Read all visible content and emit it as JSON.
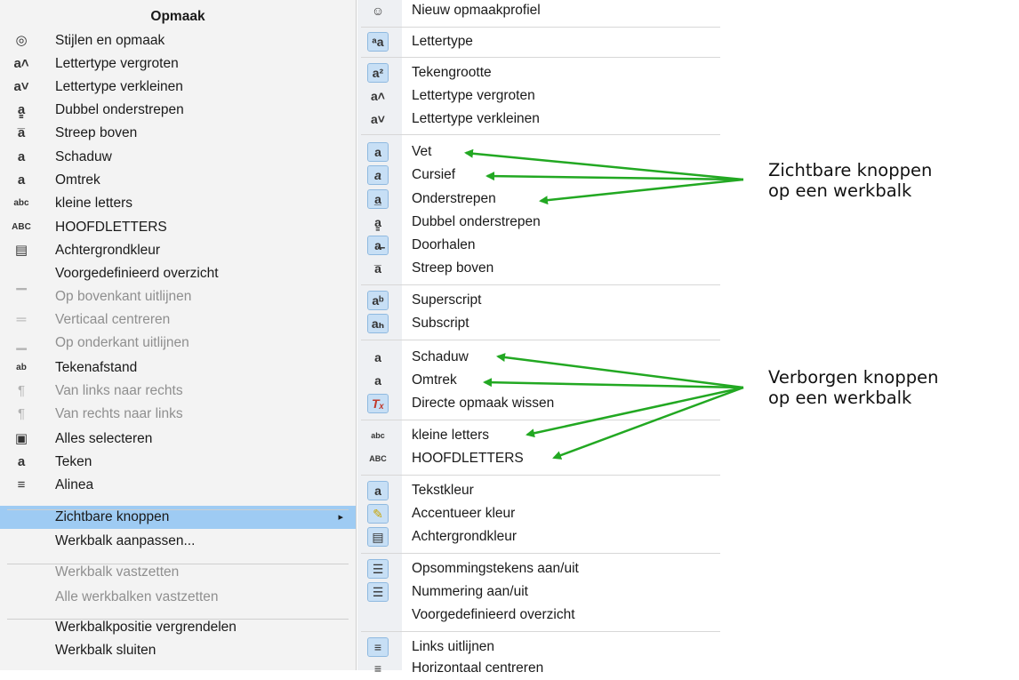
{
  "left_menu": {
    "title": "Opmaak",
    "items": [
      {
        "label": "Stijlen en opmaak",
        "icon": "styles-icon",
        "glyph": "◎",
        "disabled": false
      },
      {
        "label": "Lettertype vergroten",
        "icon": "font-grow-icon",
        "glyph": "a˄",
        "disabled": false
      },
      {
        "label": "Lettertype verkleinen",
        "icon": "font-shrink-icon",
        "glyph": "a˅",
        "disabled": false
      },
      {
        "label": "Dubbel onderstrepen",
        "icon": "double-underline-icon",
        "glyph": "a̳",
        "disabled": false
      },
      {
        "label": "Streep boven",
        "icon": "overline-icon",
        "glyph": "a̅",
        "disabled": false
      },
      {
        "label": "Schaduw",
        "icon": "shadow-icon",
        "glyph": "a",
        "disabled": false
      },
      {
        "label": "Omtrek",
        "icon": "outline-icon",
        "glyph": "a",
        "disabled": false
      },
      {
        "label": "kleine letters",
        "icon": "lowercase-icon",
        "glyph": "abc",
        "disabled": false
      },
      {
        "label": "HOOFDLETTERS",
        "icon": "uppercase-icon",
        "glyph": "ABC",
        "disabled": false
      },
      {
        "label": "Achtergrondkleur",
        "icon": "background-color-icon",
        "glyph": "▤",
        "disabled": false
      },
      {
        "label": "Voorgedefinieerd overzicht",
        "icon": "",
        "glyph": "",
        "disabled": false
      },
      {
        "label": "Op bovenkant uitlijnen",
        "icon": "align-top-icon",
        "glyph": "▔",
        "disabled": true
      },
      {
        "label": "Verticaal centreren",
        "icon": "align-middle-icon",
        "glyph": "═",
        "disabled": true
      },
      {
        "label": "Op onderkant uitlijnen",
        "icon": "align-bottom-icon",
        "glyph": "▁",
        "disabled": true
      },
      {
        "label": "Tekenafstand",
        "icon": "char-spacing-icon",
        "glyph": "ab",
        "disabled": false
      },
      {
        "label": "Van links naar rechts",
        "icon": "ltr-icon",
        "glyph": "¶",
        "disabled": true
      },
      {
        "label": "Van rechts naar links",
        "icon": "rtl-icon",
        "glyph": "¶",
        "disabled": true
      },
      {
        "label": "Alles selecteren",
        "icon": "select-all-icon",
        "glyph": "▣",
        "disabled": false
      },
      {
        "label": "Teken",
        "icon": "character-icon",
        "glyph": "a",
        "disabled": false
      },
      {
        "label": "Alinea",
        "icon": "paragraph-icon",
        "glyph": "≡",
        "disabled": false
      },
      {
        "label": "Zichtbare knoppen",
        "icon": "",
        "glyph": "",
        "disabled": false,
        "selected": true,
        "submenu_arrow": "▸"
      },
      {
        "label": "Werkbalk aanpassen...",
        "icon": "",
        "glyph": "",
        "disabled": false
      },
      {
        "label": "Werkbalk vastzetten",
        "icon": "",
        "glyph": "",
        "disabled": true
      },
      {
        "label": "Alle werkbalken vastzetten",
        "icon": "",
        "glyph": "",
        "disabled": true
      },
      {
        "label": "Werkbalkpositie vergrendelen",
        "icon": "",
        "glyph": "",
        "disabled": false
      },
      {
        "label": "Werkbalk sluiten",
        "icon": "",
        "glyph": "",
        "disabled": false
      }
    ]
  },
  "right_menu": {
    "items": [
      {
        "label": "Nieuw opmaakprofiel",
        "icon": "new-style-icon",
        "glyph": "☺",
        "checked": false
      },
      {
        "label": "Lettertype",
        "icon": "font-name-icon",
        "glyph": "ᵃa",
        "checked": true
      },
      {
        "label": "Tekengrootte",
        "icon": "font-size-icon",
        "glyph": "a²",
        "checked": true
      },
      {
        "label": "Lettertype vergroten",
        "icon": "font-grow-icon",
        "glyph": "a˄",
        "checked": false
      },
      {
        "label": "Lettertype verkleinen",
        "icon": "font-shrink-icon",
        "glyph": "a˅",
        "checked": false
      },
      {
        "label": "Vet",
        "icon": "bold-icon",
        "glyph": "a",
        "checked": true
      },
      {
        "label": "Cursief",
        "icon": "italic-icon",
        "glyph": "a",
        "checked": true
      },
      {
        "label": "Onderstrepen",
        "icon": "underline-icon",
        "glyph": "a̲",
        "checked": true
      },
      {
        "label": "Dubbel onderstrepen",
        "icon": "double-underline-icon",
        "glyph": "a̳",
        "checked": false
      },
      {
        "label": "Doorhalen",
        "icon": "strikethrough-icon",
        "glyph": "a̶",
        "checked": true
      },
      {
        "label": "Streep boven",
        "icon": "overline-icon",
        "glyph": "a̅",
        "checked": false
      },
      {
        "label": "Superscript",
        "icon": "superscript-icon",
        "glyph": "aᵇ",
        "checked": true
      },
      {
        "label": "Subscript",
        "icon": "subscript-icon",
        "glyph": "aₕ",
        "checked": true
      },
      {
        "label": "Schaduw",
        "icon": "shadow-icon",
        "glyph": "a",
        "checked": false
      },
      {
        "label": "Omtrek",
        "icon": "outline-icon",
        "glyph": "a",
        "checked": false
      },
      {
        "label": "Directe opmaak wissen",
        "icon": "clear-formatting-icon",
        "glyph": "Tₓ",
        "checked": true
      },
      {
        "label": "kleine letters",
        "icon": "lowercase-icon",
        "glyph": "abc",
        "checked": false
      },
      {
        "label": "HOOFDLETTERS",
        "icon": "uppercase-icon",
        "glyph": "ABC",
        "checked": false
      },
      {
        "label": "Tekstkleur",
        "icon": "font-color-icon",
        "glyph": "a",
        "checked": true
      },
      {
        "label": "Accentueer kleur",
        "icon": "highlight-color-icon",
        "glyph": "✎",
        "checked": true
      },
      {
        "label": "Achtergrondkleur",
        "icon": "background-color-icon",
        "glyph": "▤",
        "checked": true
      },
      {
        "label": "Opsommingstekens aan/uit",
        "icon": "bullets-icon",
        "glyph": "☰",
        "checked": true
      },
      {
        "label": "Nummering aan/uit",
        "icon": "numbering-icon",
        "glyph": "☰",
        "checked": true
      },
      {
        "label": "Voorgedefinieerd overzicht",
        "icon": "",
        "glyph": "",
        "checked": false
      },
      {
        "label": "Links uitlijnen",
        "icon": "align-left-icon",
        "glyph": "≡",
        "checked": true
      },
      {
        "label": "Horizontaal centreren",
        "icon": "align-center-icon",
        "glyph": "≡",
        "checked": false
      }
    ]
  },
  "annotations": {
    "visible_line1": "Zichtbare knoppen",
    "visible_line2": "op een werkbalk",
    "hidden_line1": "Verborgen knoppen",
    "hidden_line2": "op een werkbalk",
    "arrow_color": "#22a822"
  }
}
